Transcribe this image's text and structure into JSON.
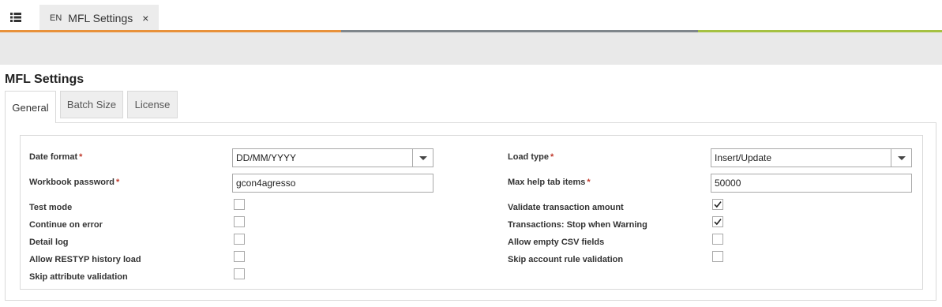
{
  "window_tab": {
    "lang": "EN",
    "title": "MFL Settings",
    "close": "×"
  },
  "strip_colors": [
    "#e8913a",
    "#7f868b",
    "#a5c142"
  ],
  "page_title": "MFL Settings",
  "tabs": [
    {
      "label": "General",
      "active": true
    },
    {
      "label": "Batch Size",
      "active": false
    },
    {
      "label": "License",
      "active": false
    }
  ],
  "left_fields": {
    "date_format": {
      "label": "Date format",
      "required_mark": "*",
      "value": "DD/MM/YYYY"
    },
    "workbook_password": {
      "label": "Workbook password",
      "required_mark": "*",
      "value": "gcon4agresso"
    },
    "test_mode": {
      "label": "Test mode",
      "checked": false
    },
    "continue_on_error": {
      "label": "Continue on error",
      "checked": false
    },
    "detail_log": {
      "label": "Detail log",
      "checked": false
    },
    "allow_restyp": {
      "label": "Allow RESTYP history load",
      "checked": false
    },
    "skip_attribute": {
      "label": "Skip attribute validation",
      "checked": false
    }
  },
  "right_fields": {
    "load_type": {
      "label": "Load type",
      "required_mark": "*",
      "value": "Insert/Update"
    },
    "max_help": {
      "label": "Max help tab items",
      "required_mark": "*",
      "value": "50000"
    },
    "validate_amount": {
      "label": "Validate transaction amount",
      "checked": true
    },
    "stop_warning": {
      "label": "Transactions: Stop when Warning",
      "checked": true
    },
    "allow_empty_csv": {
      "label": "Allow empty CSV fields",
      "checked": false
    },
    "skip_account_rule": {
      "label": "Skip account rule validation",
      "checked": false
    }
  }
}
